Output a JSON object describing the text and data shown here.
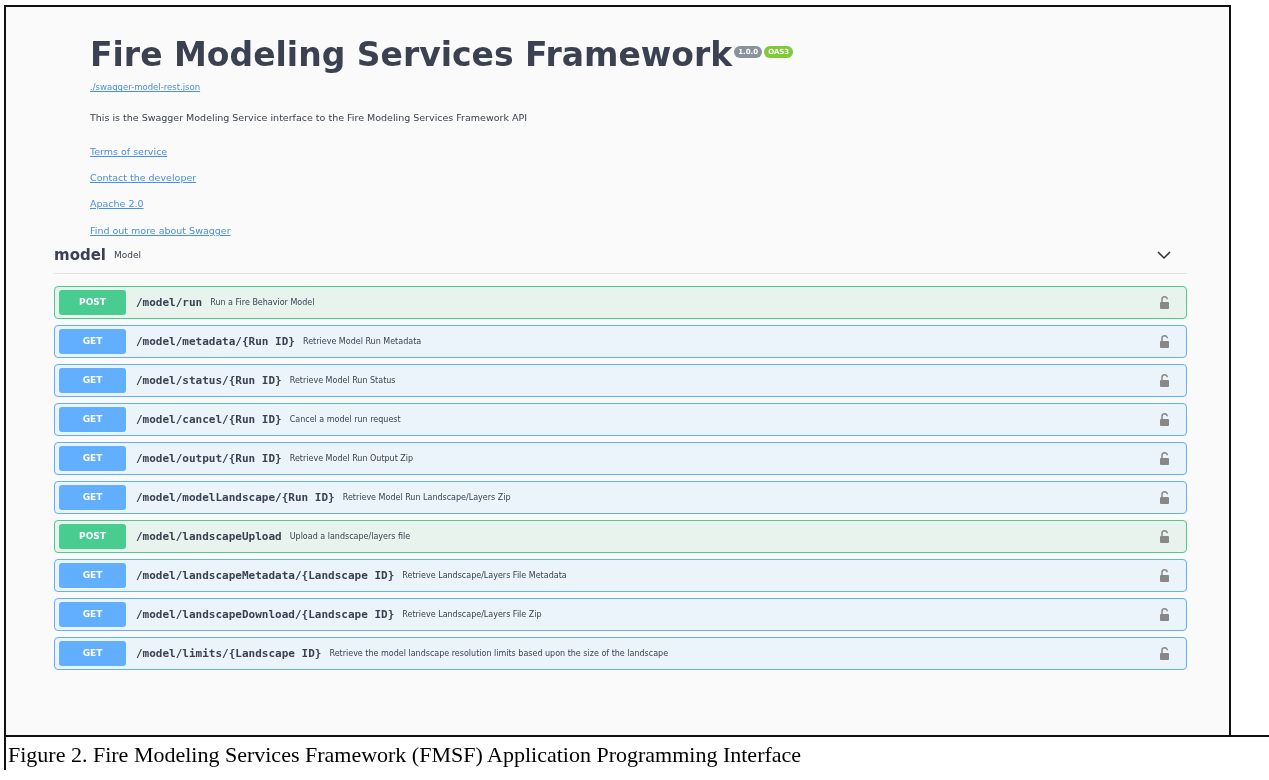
{
  "info": {
    "title": "Fire Modeling Services Framework",
    "badges": [
      {
        "label": "1.0.0",
        "color": "#89939e"
      },
      {
        "label": "OAS3",
        "color": "#7eca39"
      }
    ],
    "spec_link": "./swagger-model-rest.json",
    "description": "This is the Swagger Modeling Service interface to the Fire Modeling Services Framework API",
    "links": [
      "Terms of service",
      "Contact the developer",
      "Apache 2.0",
      "Find out more about Swagger"
    ]
  },
  "tag": {
    "name": "model",
    "description": "Model",
    "expanded": true
  },
  "operations": [
    {
      "kind": "post",
      "method": "POST",
      "path": "/model/run",
      "summary": "Run a Fire Behavior Model"
    },
    {
      "kind": "get",
      "method": "GET",
      "path": "/model/metadata/{Run ID}",
      "summary": "Retrieve Model Run Metadata"
    },
    {
      "kind": "get",
      "method": "GET",
      "path": "/model/status/{Run ID}",
      "summary": "Retrieve Model Run Status"
    },
    {
      "kind": "get",
      "method": "GET",
      "path": "/model/cancel/{Run ID}",
      "summary": "Cancel a model run request"
    },
    {
      "kind": "get",
      "method": "GET",
      "path": "/model/output/{Run ID}",
      "summary": "Retrieve Model Run Output Zip"
    },
    {
      "kind": "get",
      "method": "GET",
      "path": "/model/modelLandscape/{Run ID}",
      "summary": "Retrieve Model Run Landscape/Layers Zip"
    },
    {
      "kind": "post",
      "method": "POST",
      "path": "/model/landscapeUpload",
      "summary": "Upload a landscape/layers file"
    },
    {
      "kind": "get",
      "method": "GET",
      "path": "/model/landscapeMetadata/{Landscape ID}",
      "summary": "Retrieve Landscape/Layers File Metadata"
    },
    {
      "kind": "get",
      "method": "GET",
      "path": "/model/landscapeDownload/{Landscape ID}",
      "summary": "Retrieve Landscape/Layers File Zip"
    },
    {
      "kind": "get",
      "method": "GET",
      "path": "/model/limits/{Landscape ID}",
      "summary": "Retrieve the model landscape resolution limits based upon the size of the landscape"
    }
  ],
  "caption": "Figure 2. Fire Modeling Services Framework (FMSF) Application Programming Interface"
}
